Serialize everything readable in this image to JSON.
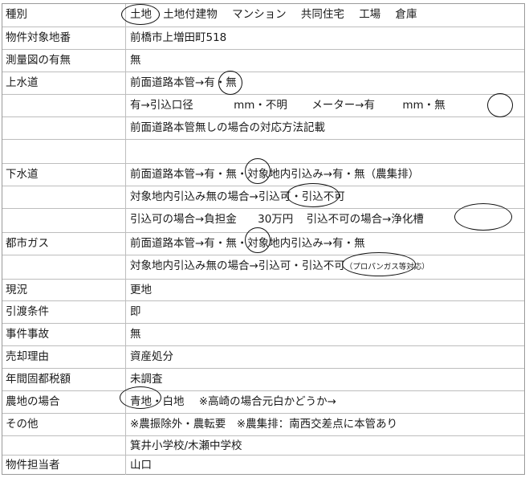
{
  "rows": [
    {
      "label": "種別",
      "parts": [
        "土地",
        "土地付建物",
        "マンション",
        "共同住宅",
        "工場",
        "倉庫"
      ]
    },
    {
      "label": "物件対象地番",
      "value": "前橋市上増田町518"
    },
    {
      "label": "測量図の有無",
      "value": "無"
    },
    {
      "label": "上水道",
      "line1": [
        "前面道路本管→",
        "有",
        "・無"
      ],
      "line2": [
        "有→引込口径",
        "mm・不明",
        "メーター→有",
        "mm・",
        "無"
      ],
      "line3": "前面道路本管無しの場合の対応方法記載"
    },
    {
      "label": "下水道",
      "line1": [
        "前面道路本管→有・",
        "無",
        "・対象地内引込み→有・無（農集排）"
      ],
      "line2": [
        "対象地内引込み無の場合→",
        "引込可",
        "・引込不可"
      ],
      "line3": [
        "引込可の場合→負担金",
        "30万円",
        "引込不可の場合→",
        "浄化槽"
      ]
    },
    {
      "label": "都市ガス",
      "line1": [
        "前面道路本管→有・",
        "無",
        "・対象地内引込み→有・無"
      ],
      "line2": [
        "対象地内引込み無の場合→引込可・",
        "引込不可",
        "（プロパンガス等対応）"
      ]
    },
    {
      "label": "現況",
      "value": "更地"
    },
    {
      "label": "引渡条件",
      "value": "即"
    },
    {
      "label": "事件事故",
      "value": "無"
    },
    {
      "label": "売却理由",
      "value": "資産処分"
    },
    {
      "label": "年間固都税額",
      "value": "未調査"
    },
    {
      "label": "農地の場合",
      "parts": [
        "青地",
        "・白地",
        "※高崎の場合元白かどうか→"
      ]
    },
    {
      "label": "その他",
      "line1": "※農振除外・農転要　※農集排：南西交差点に本管あり",
      "line2": "箕井小学校/木瀬中学校"
    },
    {
      "label": "物件担当者",
      "value": "山口"
    }
  ]
}
